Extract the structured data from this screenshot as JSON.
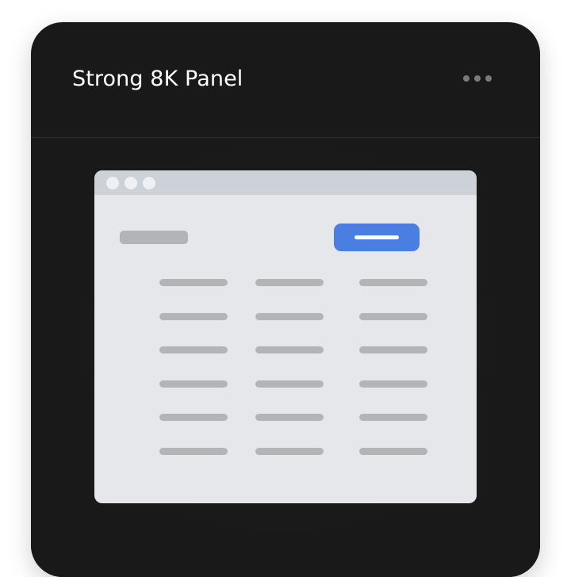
{
  "panel": {
    "title": "Strong 8K Panel",
    "menu_icon": "more-horizontal-icon"
  },
  "mockup": {
    "window_controls": 3,
    "row_count": 6,
    "column_count": 3,
    "colors": {
      "panel_background": "#191919",
      "browser_background": "#e6e7ea",
      "browser_titlebar": "#cdd2d9",
      "placeholder": "#b3b4b6",
      "accent_button": "#4a7ee0"
    }
  }
}
